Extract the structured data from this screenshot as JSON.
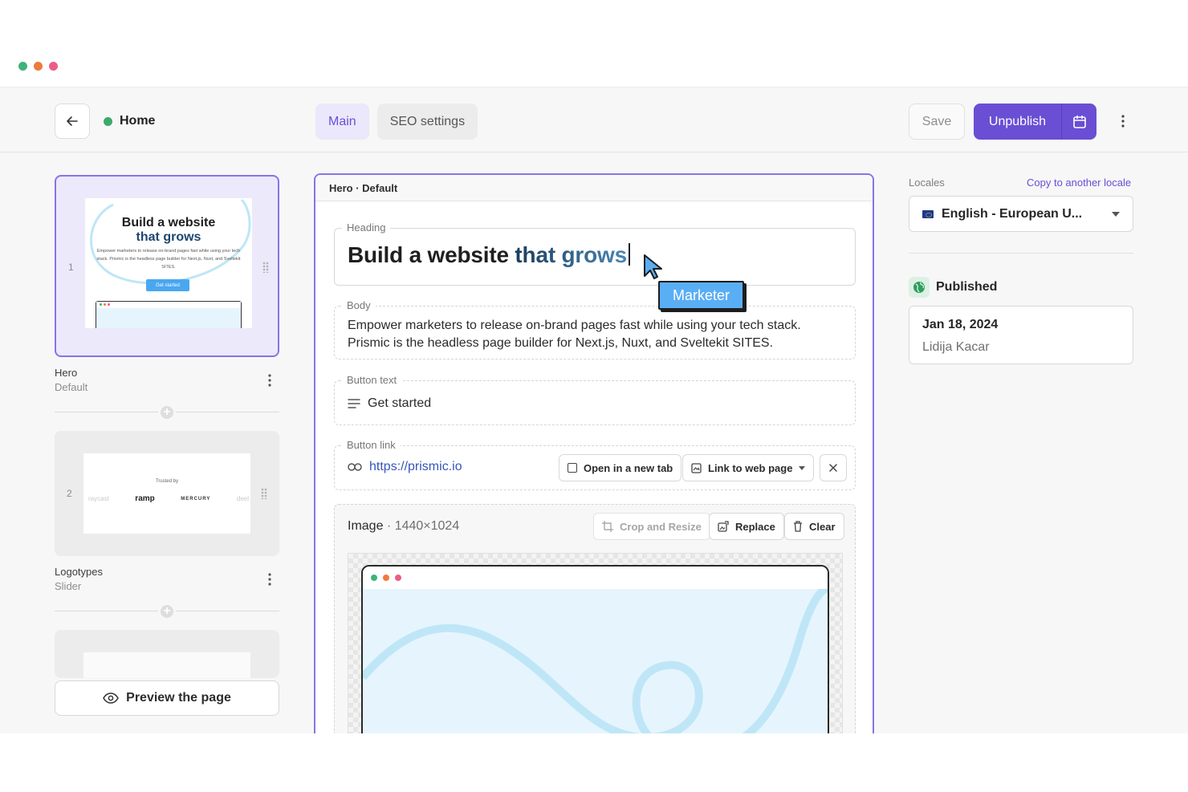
{
  "window": {
    "dot_colors": [
      "#3db37a",
      "#ee7a3b",
      "#ec5d86"
    ]
  },
  "header": {
    "back_icon": "arrow-left-icon",
    "document_title": "Home",
    "status_color": "#3baa6b",
    "tabs": [
      {
        "label": "Main",
        "active": true
      },
      {
        "label": "SEO settings",
        "active": false
      }
    ],
    "save_label": "Save",
    "unpublish_label": "Unpublish",
    "schedule_icon": "calendar-icon",
    "more_icon": "kebab-menu-icon",
    "accent_color": "#6a4ed4"
  },
  "slices": [
    {
      "number": "1",
      "name": "Hero",
      "variation": "Default",
      "thumbnail": {
        "title_line1": "Build a website",
        "title_line2": "that grows",
        "body": "Empower marketers to release on-brand pages fast while using your tech stack. Prismic is the headless page builder for Next.js, Nuxt, and Sveltekit SITES.",
        "button": "Get started"
      }
    },
    {
      "number": "2",
      "name": "Logotypes",
      "variation": "Slider",
      "thumbnail": {
        "caption": "Trusted by",
        "logos": [
          "raycast",
          "ramp",
          "MERCURY",
          "deel"
        ]
      }
    }
  ],
  "preview_label": "Preview the page",
  "editor": {
    "slice_header": "Hero · Default",
    "heading_label": "Heading",
    "heading_part1": "Build a website",
    "heading_part2": "that grows",
    "body_label": "Body",
    "body_line1": "Empower marketers to release on-brand pages fast while using your tech stack.",
    "body_line2": "Prismic is the headless page builder for Next.js, Nuxt, and Sveltekit SITES.",
    "button_text_label": "Button text",
    "button_text_value": "Get started",
    "button_link_label": "Button link",
    "button_link_value": "https://prismic.io",
    "open_new_tab_label": "Open in a new tab",
    "link_type_label": "Link to web page",
    "image_label": "Image",
    "image_dims": "· 1440×1024",
    "crop_label": "Crop and Resize",
    "replace_label": "Replace",
    "clear_label": "Clear",
    "heading_gradient": [
      "#1f1f1f",
      "#1c3d5c",
      "#4a88b5"
    ]
  },
  "cursor": {
    "tag": "Marketer",
    "color": "#5aaef4"
  },
  "sidebar": {
    "locales_label": "Locales",
    "copy_locale": "Copy to another locale",
    "locale_value": "English - European U...",
    "status_label": "Published",
    "status_icon": "globe-icon",
    "publish_date": "Jan 18, 2024",
    "publish_user": "Lidija Kacar"
  }
}
